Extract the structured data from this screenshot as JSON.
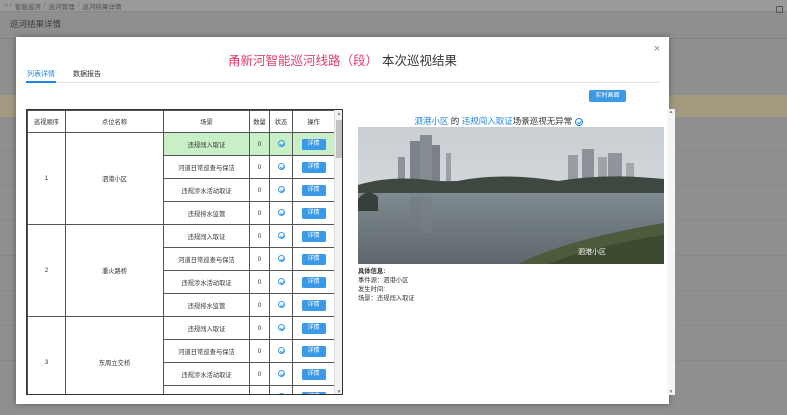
{
  "background": {
    "breadcrumb": [
      "智能巡河",
      "巡河管理",
      "巡河结果详情"
    ],
    "page_title": "巡河结果详情"
  },
  "modal": {
    "title_highlight": "甬新河智能巡河线路（段）",
    "title_rest": "本次巡视结果",
    "close_label": "×",
    "tabs": [
      {
        "label": "列表详情",
        "active": true
      },
      {
        "label": "数据报告",
        "active": false
      }
    ],
    "monitor_button": "实时画面"
  },
  "table": {
    "headers": [
      "巡视顺序",
      "点位名称",
      "场景",
      "数量",
      "状态",
      "操作"
    ],
    "detail_label": "详情",
    "groups": [
      {
        "order": "1",
        "name": "泗港小区",
        "rows": [
          {
            "scene": "违规闯入取证",
            "count": "0",
            "highlight": true
          },
          {
            "scene": "河道日常巡查与保洁",
            "count": "0"
          },
          {
            "scene": "违规涉水活动取证",
            "count": "0"
          },
          {
            "scene": "违规排水监管",
            "count": "0"
          }
        ]
      },
      {
        "order": "2",
        "name": "潘火路桥",
        "rows": [
          {
            "scene": "违规闯入取证",
            "count": "0"
          },
          {
            "scene": "河道日常巡查与保洁",
            "count": "0"
          },
          {
            "scene": "违规涉水活动取证",
            "count": "0"
          },
          {
            "scene": "违规排水监管",
            "count": "0"
          }
        ]
      },
      {
        "order": "3",
        "name": "东周立交桥",
        "rows": [
          {
            "scene": "违规闯入取证",
            "count": "0"
          },
          {
            "scene": "河道日常巡查与保洁",
            "count": "0"
          },
          {
            "scene": "违规涉水活动取证",
            "count": "0"
          },
          {
            "scene": "违规排水监管",
            "count": "0"
          }
        ]
      }
    ]
  },
  "panel": {
    "location": "泗港小区",
    "de": "的",
    "scene": "违规闯入取证",
    "result_text": "场景巡视无异常",
    "photo_caption": "泗港小区",
    "info_title": "具体信息:",
    "info_lines": [
      "事件源：泗港小区",
      "发生时间:",
      "场景：违规闯入取证"
    ]
  }
}
